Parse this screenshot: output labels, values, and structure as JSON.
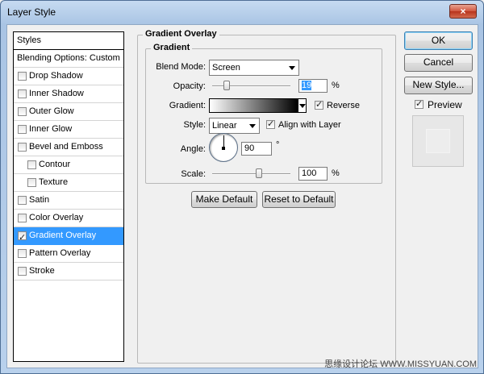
{
  "window": {
    "title": "Layer Style",
    "close_glyph": "×"
  },
  "styles_list": {
    "header": "Styles",
    "items": [
      {
        "label": "Blending Options: Custom",
        "checkbox": false,
        "checked": false,
        "indent": false,
        "selected": false
      },
      {
        "label": "Drop Shadow",
        "checkbox": true,
        "checked": false,
        "indent": false,
        "selected": false
      },
      {
        "label": "Inner Shadow",
        "checkbox": true,
        "checked": false,
        "indent": false,
        "selected": false
      },
      {
        "label": "Outer Glow",
        "checkbox": true,
        "checked": false,
        "indent": false,
        "selected": false
      },
      {
        "label": "Inner Glow",
        "checkbox": true,
        "checked": false,
        "indent": false,
        "selected": false
      },
      {
        "label": "Bevel and Emboss",
        "checkbox": true,
        "checked": false,
        "indent": false,
        "selected": false
      },
      {
        "label": "Contour",
        "checkbox": true,
        "checked": false,
        "indent": true,
        "selected": false
      },
      {
        "label": "Texture",
        "checkbox": true,
        "checked": false,
        "indent": true,
        "selected": false
      },
      {
        "label": "Satin",
        "checkbox": true,
        "checked": false,
        "indent": false,
        "selected": false
      },
      {
        "label": "Color Overlay",
        "checkbox": true,
        "checked": false,
        "indent": false,
        "selected": false
      },
      {
        "label": "Gradient Overlay",
        "checkbox": true,
        "checked": true,
        "indent": false,
        "selected": true
      },
      {
        "label": "Pattern Overlay",
        "checkbox": true,
        "checked": false,
        "indent": false,
        "selected": false
      },
      {
        "label": "Stroke",
        "checkbox": true,
        "checked": false,
        "indent": false,
        "selected": false
      }
    ]
  },
  "panel": {
    "outer_title": "Gradient Overlay",
    "inner_title": "Gradient",
    "blend_mode_label": "Blend Mode:",
    "blend_mode_value": "Screen",
    "opacity_label": "Opacity:",
    "opacity_value": "19",
    "opacity_unit": "%",
    "opacity_level": 0.19,
    "gradient_label": "Gradient:",
    "gradient_colors": [
      "#ffffff",
      "#000000"
    ],
    "reverse_label": "Reverse",
    "reverse_checked": true,
    "style_label": "Style:",
    "style_value": "Linear",
    "align_label": "Align with Layer",
    "align_checked": true,
    "angle_label": "Angle:",
    "angle_value": "90",
    "angle_unit": "°",
    "scale_label": "Scale:",
    "scale_value": "100",
    "scale_unit": "%",
    "scale_level": 0.6,
    "make_default_label": "Make Default",
    "reset_default_label": "Reset to Default"
  },
  "right": {
    "ok_label": "OK",
    "cancel_label": "Cancel",
    "new_style_label": "New Style...",
    "preview_label": "Preview",
    "preview_checked": true
  },
  "watermark": "思缘设计论坛  WWW.MISSYUAN.COM",
  "colors": {
    "selection": "#3399ff",
    "title_gradient_top": "#c7dbf1",
    "close_button": "#d0563e"
  }
}
